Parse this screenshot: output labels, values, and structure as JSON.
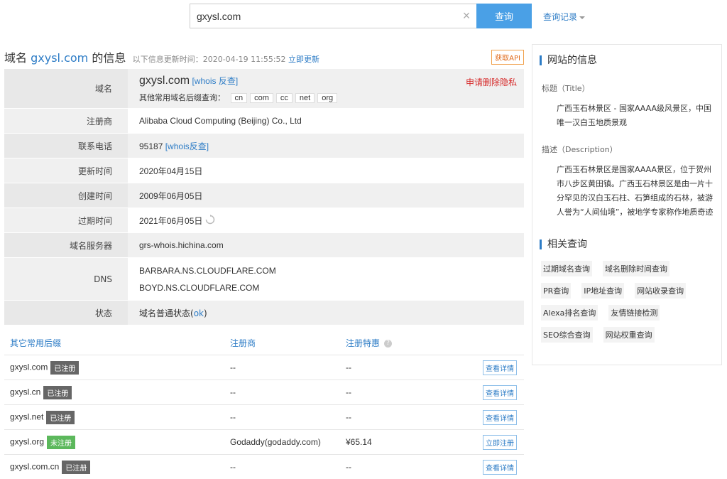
{
  "search": {
    "value": "gxysl.com",
    "button": "查询",
    "history": "查询记录"
  },
  "header": {
    "prefix": "域名",
    "domain": "gxysl.com",
    "suffix": "的信息",
    "update_text": "以下信息更新时间：2020-04-19 11:55:52",
    "update_now": "立即更新",
    "api": "获取API"
  },
  "info": {
    "domain_label": "域名",
    "domain_value": "gxysl.com",
    "whois_link": "[whois 反查]",
    "delete_privacy": "申请删除隐私",
    "other_suffix_label": "其他常用域名后缀查询：",
    "suffixes": [
      "cn",
      "com",
      "cc",
      "net",
      "org"
    ],
    "registrar_label": "注册商",
    "registrar_value": "Alibaba Cloud Computing (Beijing) Co., Ltd",
    "phone_label": "联系电话",
    "phone_value": "95187",
    "phone_whois": "[whois反查]",
    "updated_label": "更新时间",
    "updated_value": "2020年04月15日",
    "created_label": "创建时间",
    "created_value": "2009年06月05日",
    "expires_label": "过期时间",
    "expires_value": "2021年06月05日",
    "ns_label": "域名服务器",
    "ns_value": "grs-whois.hichina.com",
    "dns_label": "DNS",
    "dns_1": "BARBARA.NS.CLOUDFLARE.COM",
    "dns_2": "BOYD.NS.CLOUDFLARE.COM",
    "status_label": "状态",
    "status_prefix": "域名普通状态(",
    "status_link": "ok",
    "status_suffix": ")"
  },
  "suffix_table": {
    "headers": [
      "其它常用后缀",
      "注册商",
      "注册特惠"
    ],
    "rows": [
      {
        "domain": "gxysl.com",
        "badge": "已注册",
        "registrar": "--",
        "price": "--",
        "action": "查看详情",
        "registered": true
      },
      {
        "domain": "gxysl.cn",
        "badge": "已注册",
        "registrar": "--",
        "price": "--",
        "action": "查看详情",
        "registered": true
      },
      {
        "domain": "gxysl.net",
        "badge": "已注册",
        "registrar": "--",
        "price": "--",
        "action": "查看详情",
        "registered": true
      },
      {
        "domain": "gxysl.org",
        "badge": "未注册",
        "registrar": "Godaddy(godaddy.com)",
        "price": "¥65.14",
        "action": "立即注册",
        "registered": false
      },
      {
        "domain": "gxysl.com.cn",
        "badge": "已注册",
        "registrar": "--",
        "price": "--",
        "action": "查看详情",
        "registered": true
      }
    ]
  },
  "sidebar": {
    "site_info_title": "网站的信息",
    "title_label": "标题（Title）",
    "title_value": "广西玉石林景区 - 国家AAAA级风景区，中国唯一汉白玉地质景观",
    "desc_label": "描述（Description）",
    "desc_value": "广西玉石林景区是国家AAAA景区，位于贺州市八步区黄田镇。广西玉石林景区是由一片十分罕见的汉白玉石柱、石笋组成的石林，被游人誉为“人间仙境”，被地学专家称作地质奇迹",
    "related_title": "相关查询",
    "related": [
      "过期域名查询",
      "域名删除时间查询",
      "PR查询",
      "IP地址查询",
      "网站收录查询",
      "Alexa排名查询",
      "友情链接检测",
      "SEO综合查询",
      "网站权重查询"
    ]
  },
  "colors": {
    "accent": "#2d7cc6",
    "search_button": "#4aa0e6",
    "danger": "#d62b2b",
    "registered_badge": "#666666",
    "unregistered_badge": "#5cb85c"
  }
}
